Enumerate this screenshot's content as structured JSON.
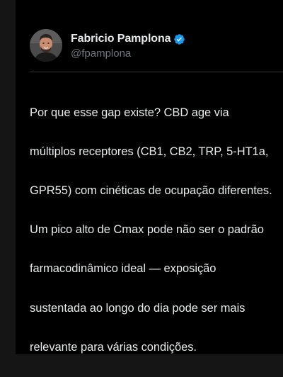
{
  "post": {
    "author": {
      "name": "Fabricio Pamplona",
      "handle": "@fpamplona",
      "verified": true,
      "avatar_icon": "avatar-photo"
    },
    "text_lines": [
      "Por que esse gap existe? CBD age via",
      "múltiplos receptores (CB1, CB2, TRP, 5-HT1a,",
      "GPR55) com cinéticas de ocupação diferentes.",
      "Um pico alto de Cmax pode não ser o padrão",
      "farmacodinâmico ideal — exposição",
      "sustentada ao longo do dia pode ser mais",
      "relevante para várias condições."
    ]
  },
  "colors": {
    "background": "#000000",
    "text_primary": "#e7e9ea",
    "text_secondary": "#71767b",
    "verified_badge": "#1d9bf0",
    "divider": "#2f3336"
  }
}
